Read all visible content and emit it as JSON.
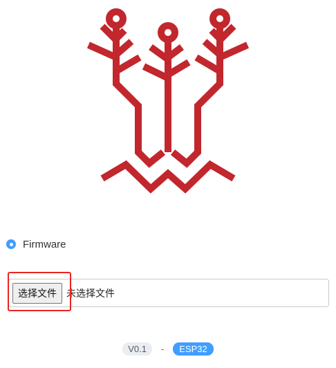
{
  "logo": {
    "icon": "tree-circuit-logo",
    "color": "#c1272d"
  },
  "mode": {
    "selected": true,
    "label": "Firmware"
  },
  "file_input": {
    "button_label": "选择文件",
    "status_text": "未选择文件",
    "highlight_color": "#e8261f"
  },
  "footer": {
    "version": "V0.1",
    "separator": "-",
    "chip": "ESP32",
    "chip_color": "#409eff"
  }
}
